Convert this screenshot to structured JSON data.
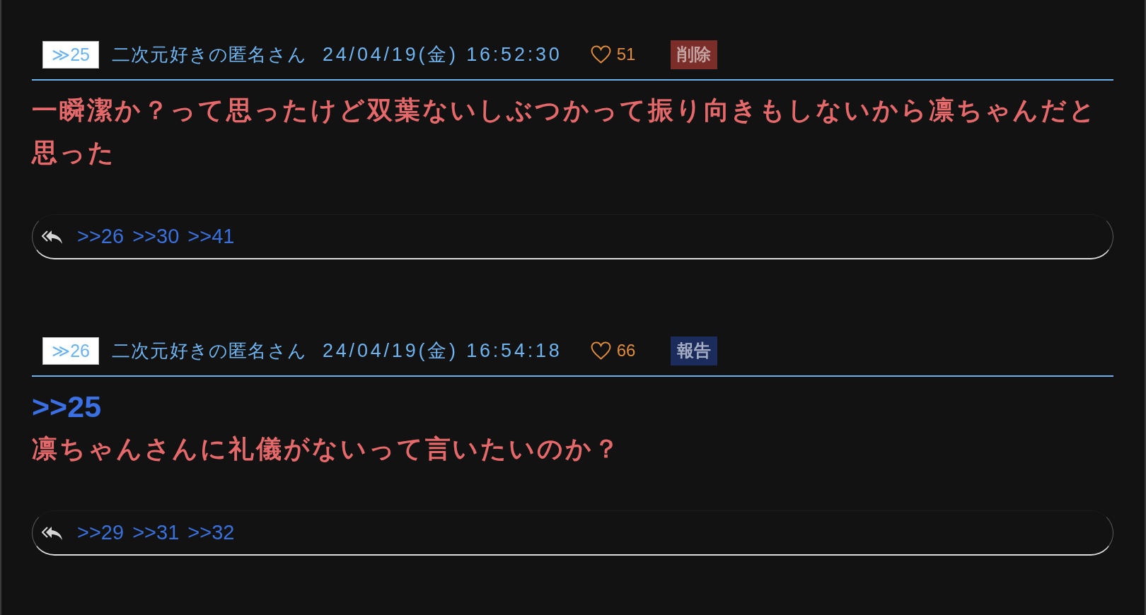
{
  "posts": [
    {
      "number": "≫25",
      "name": "二次元好きの匿名さん",
      "date": "24/04/19(金) 16:52:30",
      "likes": "51",
      "action": {
        "kind": "delete",
        "label": "削除"
      },
      "body": [
        {
          "kind": "text",
          "text": "一瞬潔か？って思ったけど双葉ないしぶつかって振り向きもしないから凛ちゃんだと思った"
        }
      ],
      "replies": [
        ">>26",
        ">>30",
        ">>41"
      ]
    },
    {
      "number": "≫26",
      "name": "二次元好きの匿名さん",
      "date": "24/04/19(金) 16:54:18",
      "likes": "66",
      "action": {
        "kind": "report",
        "label": "報告"
      },
      "body": [
        {
          "kind": "quote",
          "text": ">>25"
        },
        {
          "kind": "text",
          "text": "凛ちゃんさんに礼儀がないって言いたいのか？"
        }
      ],
      "replies": [
        ">>29",
        ">>31",
        ">>32"
      ]
    }
  ]
}
